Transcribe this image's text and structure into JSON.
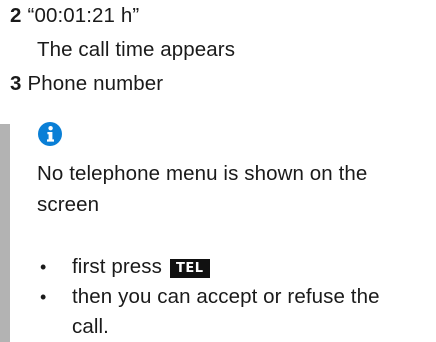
{
  "steps": [
    {
      "number": "2",
      "label": "“00:01:21 h”",
      "detail": "The call time appears"
    },
    {
      "number": "3",
      "label": "Phone number"
    }
  ],
  "note": {
    "icon": "info-icon",
    "accent_color": "#0a7fd6",
    "bar_color": "#b3b3b3",
    "text_line1": "No telephone menu is shown on the",
    "text_line2": "screen",
    "bullets": [
      {
        "text": "first press",
        "key": "TEL"
      },
      {
        "text_line1": "then you can accept or refuse the",
        "text_line2": "call."
      }
    ]
  }
}
